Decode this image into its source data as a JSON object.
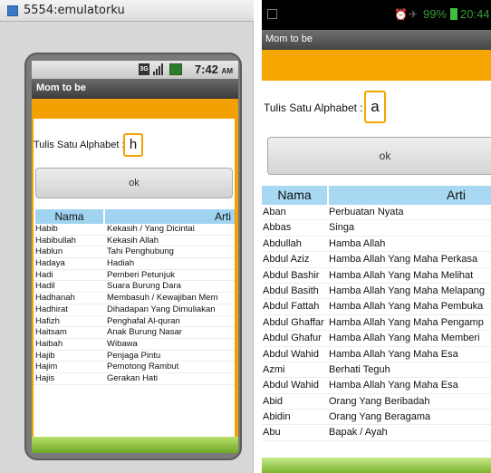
{
  "emulator": {
    "window_title": "5554:emulatorku",
    "status_time": "7:42",
    "status_ampm": "AM",
    "status_network": "3G"
  },
  "left_app": {
    "title": "Mom to be",
    "input_label": "Tulis Satu Alphabet :",
    "input_value": "h",
    "ok_label": "ok",
    "columns": [
      "Nama",
      "Arti"
    ],
    "rows": [
      {
        "nama": "Habib",
        "arti": "Kekasih / Yang Dicintai"
      },
      {
        "nama": "Habibullah",
        "arti": "Kekasih Allah"
      },
      {
        "nama": "Hablun",
        "arti": "Tahi Penghubung"
      },
      {
        "nama": "Hadaya",
        "arti": "Hadiah"
      },
      {
        "nama": "Hadi",
        "arti": "Pemberi Petunjuk"
      },
      {
        "nama": "Hadil",
        "arti": "Suara Burung Dara"
      },
      {
        "nama": "Hadhanah",
        "arti": "Membasuh / Kewajiban Mem"
      },
      {
        "nama": "Hadhirat",
        "arti": "Dihadapan Yang Dimuliakan"
      },
      {
        "nama": "Hafizh",
        "arti": "Penghafal Al-quran"
      },
      {
        "nama": "Haitsam",
        "arti": "Anak Burung Nasar"
      },
      {
        "nama": "Haibah",
        "arti": "Wibawa"
      },
      {
        "nama": "Hajib",
        "arti": "Penjaga Pintu"
      },
      {
        "nama": "Hajim",
        "arti": "Pemotong Rambut"
      },
      {
        "nama": "Hajis",
        "arti": "Gerakan Hati"
      }
    ]
  },
  "right_app": {
    "status_battery": "99%",
    "status_time": "20:44",
    "title": "Mom to be",
    "input_label": "Tulis Satu Alphabet :",
    "input_value": "a",
    "ok_label": "ok",
    "columns": [
      "Nama",
      "Arti"
    ],
    "rows": [
      {
        "nama": "Aban",
        "arti": "Perbuatan Nyata"
      },
      {
        "nama": "Abbas",
        "arti": "Singa"
      },
      {
        "nama": "Abdullah",
        "arti": "Hamba Allah"
      },
      {
        "nama": "Abdul Aziz",
        "arti": "Hamba Allah Yang Maha Perkasa"
      },
      {
        "nama": "Abdul Bashir",
        "arti": "Hamba Allah Yang Maha Melihat"
      },
      {
        "nama": "Abdul Basith",
        "arti": "Hamba Allah Yang Maha Melapang"
      },
      {
        "nama": "Abdul Fattah",
        "arti": "Hamba Allah Yang Maha Pembuka"
      },
      {
        "nama": "Abdul Ghaffar",
        "arti": "Hamba Allah Yang Maha Pengamp"
      },
      {
        "nama": "Abdul Ghafur",
        "arti": "Hamba Allah Yang Maha Memberi"
      },
      {
        "nama": "Abdul Wahid",
        "arti": "Hamba Allah Yang Maha Esa"
      },
      {
        "nama": "Azmi",
        "arti": "Berhati Teguh"
      },
      {
        "nama": "Abdul Wahid",
        "arti": "Hamba Allah Yang Maha Esa"
      },
      {
        "nama": "Abid",
        "arti": "Orang Yang Beribadah"
      },
      {
        "nama": "Abidin",
        "arti": "Orang Yang Beragama"
      },
      {
        "nama": "Abu",
        "arti": "Bapak / Ayah"
      }
    ]
  }
}
